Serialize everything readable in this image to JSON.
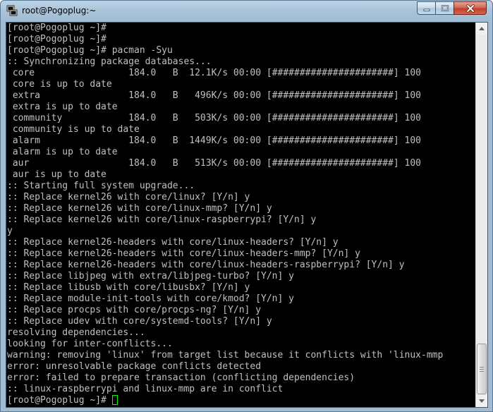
{
  "window": {
    "title": "root@Pogoplug:~",
    "icons": {
      "app": "putty-terminal-icon",
      "minimize": "minimize-icon",
      "maximize": "maximize-icon",
      "close": "close-icon",
      "scroll_up": "scroll-up-arrow-icon",
      "scroll_down": "scroll-down-arrow-icon"
    }
  },
  "terminal": {
    "lines": [
      "[root@Pogoplug ~]#",
      "[root@Pogoplug ~]#",
      "[root@Pogoplug ~]# pacman -Syu",
      ":: Synchronizing package databases...",
      " core                 184.0   B  12.1K/s 00:00 [######################] 100",
      " core is up to date",
      " extra                184.0   B   496K/s 00:00 [######################] 100",
      " extra is up to date",
      " community            184.0   B   503K/s 00:00 [######################] 100",
      " community is up to date",
      " alarm                184.0   B  1449K/s 00:00 [######################] 100",
      " alarm is up to date",
      " aur                  184.0   B   513K/s 00:00 [######################] 100",
      " aur is up to date",
      ":: Starting full system upgrade...",
      ":: Replace kernel26 with core/linux? [Y/n] y",
      ":: Replace kernel26 with core/linux-mmp? [Y/n] y",
      ":: Replace kernel26 with core/linux-raspberrypi? [Y/n] y",
      "y",
      ":: Replace kernel26-headers with core/linux-headers? [Y/n] y",
      ":: Replace kernel26-headers with core/linux-headers-mmp? [Y/n] y",
      ":: Replace kernel26-headers with core/linux-headers-raspberrypi? [Y/n] y",
      ":: Replace libjpeg with extra/libjpeg-turbo? [Y/n] y",
      ":: Replace libusb with core/libusbx? [Y/n] y",
      ":: Replace module-init-tools with core/kmod? [Y/n] y",
      ":: Replace procps with core/procps-ng? [Y/n] y",
      ":: Replace udev with core/systemd-tools? [Y/n] y",
      "resolving dependencies...",
      "looking for inter-conflicts...",
      "warning: removing 'linux' from target list because it conflicts with 'linux-mmp",
      "error: unresolvable package conflicts detected",
      "error: failed to prepare transaction (conflicting dependencies)",
      ":: linux-raspberrypi and linux-mmp are in conflict"
    ],
    "prompt": "[root@Pogoplug ~]# ",
    "colors": {
      "background": "#000000",
      "text": "#c0c0c0",
      "cursor": "#00ff00"
    },
    "scroll_position": 0.93
  }
}
